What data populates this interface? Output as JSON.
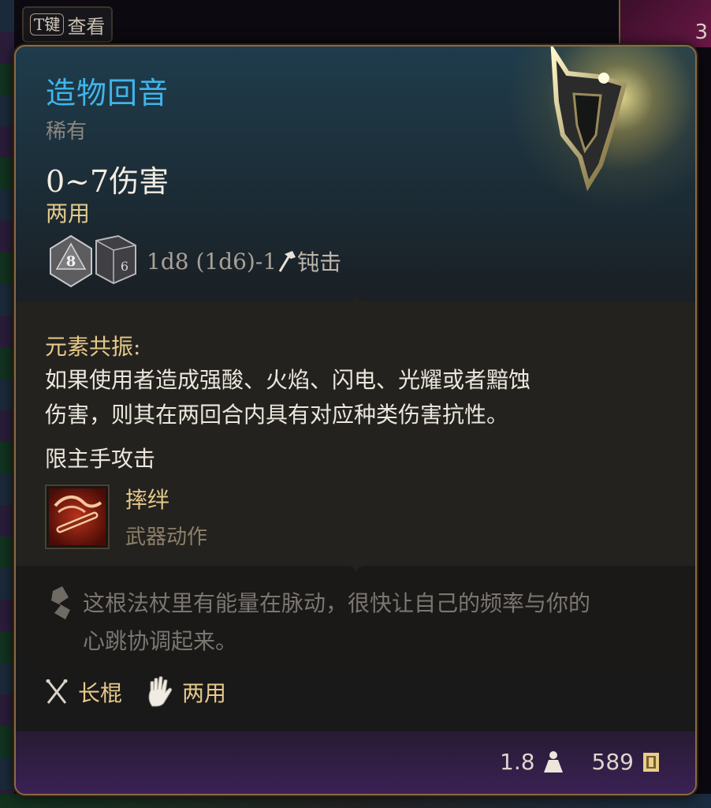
{
  "hint": {
    "key": "T键",
    "label": "查看"
  },
  "inventory": {
    "stack_count": "3"
  },
  "item": {
    "name": "造物回音",
    "rarity": "稀有",
    "damage": "0~7伤害",
    "hands": "两用",
    "dice": {
      "d8_face": "8",
      "d6_face": "6",
      "formula": "1d8 (1d6)-1",
      "damage_type": "钝击"
    }
  },
  "effect": {
    "title": "元素共振:",
    "description_lines": [
      "如果使用者造成强酸、火焰、闪电、光耀或者黯蚀",
      "伤害，则其在两回合内具有对应种类伤害抗性。"
    ],
    "restriction": "限主手攻击"
  },
  "action": {
    "name": "摔绊",
    "type": "武器动作"
  },
  "flavor": {
    "lines": [
      "这根法杖里有能量在脉动，很快让自己的频率与你的",
      "心跳协调起来。"
    ]
  },
  "tags": [
    {
      "icon": "crossed-staves-icon",
      "label": "长棍"
    },
    {
      "icon": "hand-icon",
      "label": "两用"
    }
  ],
  "footer": {
    "weight": "1.8",
    "weight_icon": "weight-icon",
    "value": "589",
    "value_icon": "gold-coin-icon"
  },
  "colors": {
    "title": "#3fb5ea",
    "accent_gold": "#e6c98a",
    "border": "#8a6a45",
    "footer_purple": "#3a2154"
  }
}
